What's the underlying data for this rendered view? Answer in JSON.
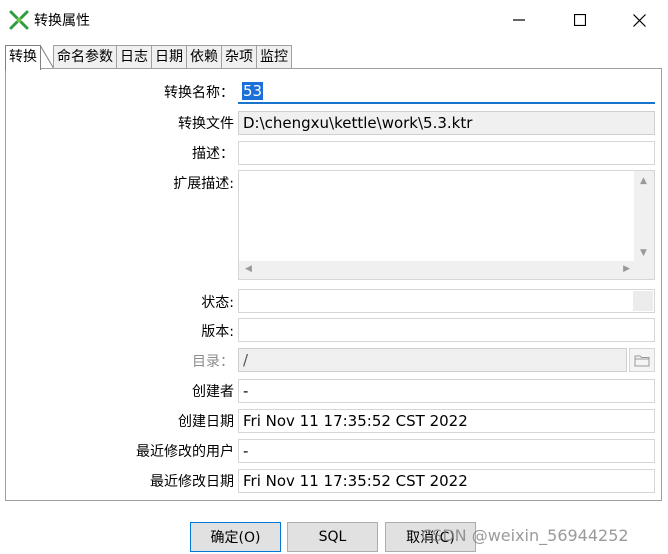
{
  "window": {
    "title": "转换属性",
    "minimize": "minimize",
    "maximize": "maximize",
    "close": "close"
  },
  "tabs": [
    {
      "label": "转换",
      "active": true
    },
    {
      "label": "命名参数"
    },
    {
      "label": "日志"
    },
    {
      "label": "日期"
    },
    {
      "label": "依赖"
    },
    {
      "label": "杂项"
    },
    {
      "label": "监控"
    }
  ],
  "form": {
    "name_label": "转换名称：",
    "name_value": "53",
    "file_label": "转换文件",
    "file_value": "D:\\chengxu\\kettle\\work\\5.3.ktr",
    "desc_label": "描述：",
    "desc_value": "",
    "ext_desc_label": "扩展描述:",
    "ext_desc_value": "",
    "status_label": "状态:",
    "status_value": "",
    "version_label": "版本:",
    "version_value": "",
    "dir_label": "目录：",
    "dir_value": "/",
    "creator_label": "创建者",
    "creator_value": "-",
    "created_label": "创建日期",
    "created_value": "Fri Nov 11 17:35:52 CST 2022",
    "modified_user_label": "最近修改的用户",
    "modified_user_value": "-",
    "modified_date_label": "最近修改日期",
    "modified_date_value": "Fri Nov 11 17:35:52 CST 2022"
  },
  "buttons": {
    "ok": "确定(O)",
    "sql": "SQL",
    "cancel": "取消(C)"
  },
  "watermark": "CSDN @weixin_56944252",
  "colors": {
    "accent": "#0078d7",
    "selection": "#1a6fd8",
    "icon_green": "#2e9e3e"
  }
}
